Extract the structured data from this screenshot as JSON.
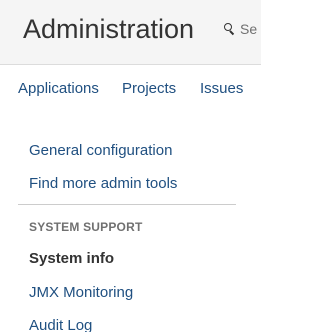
{
  "header": {
    "title": "Administration",
    "search_placeholder": "Se"
  },
  "tabs": [
    {
      "label": "Applications"
    },
    {
      "label": "Projects"
    },
    {
      "label": "Issues"
    }
  ],
  "sidebar": {
    "links": [
      {
        "label": "General configuration"
      },
      {
        "label": "Find more admin tools"
      }
    ],
    "section": {
      "heading": "SYSTEM SUPPORT",
      "items": [
        {
          "label": "System info",
          "selected": true
        },
        {
          "label": "JMX Monitoring"
        },
        {
          "label": "Audit Log"
        }
      ]
    }
  },
  "colors": {
    "link": "#205081",
    "header_background": "#f5f5f5",
    "selected_text": "#333333"
  },
  "icons": {
    "search": "search-icon"
  }
}
